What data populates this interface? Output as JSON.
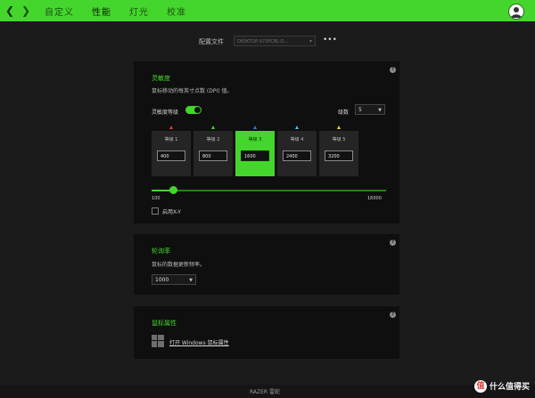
{
  "nav": {
    "tabs": [
      {
        "label": "自定义"
      },
      {
        "label": "性能"
      },
      {
        "label": "灯光"
      },
      {
        "label": "校准"
      }
    ],
    "active_tab": "性能"
  },
  "profile": {
    "label": "配置文件",
    "value": "DESKTOP-973PCBL-D...",
    "more": "•••"
  },
  "sensitivity": {
    "title": "灵敏度",
    "description": "鼠标移动的每英寸点数 (DPI) 值。",
    "stages_toggle_label": "灵敏度等级",
    "stages_enabled": true,
    "levels_label": "级数",
    "levels_value": "5",
    "stages": [
      {
        "name": "等级 1",
        "value": "400",
        "marker_color": "#e23b3b"
      },
      {
        "name": "等级 2",
        "value": "800",
        "marker_color": "#44d62c"
      },
      {
        "name": "等级 3",
        "value": "1600",
        "marker_color": "#2a7bdc"
      },
      {
        "name": "等级 4",
        "value": "2400",
        "marker_color": "#3fc6d6"
      },
      {
        "name": "等级 5",
        "value": "3200",
        "marker_color": "#e9d63a"
      }
    ],
    "active_stage": 3,
    "slider_min": "100",
    "slider_max": "16000",
    "slider_value": 1600,
    "enable_xy_label": "启用X-Y"
  },
  "polling": {
    "title": "轮询率",
    "description": "鼠标的数据更新频率。",
    "value": "1000"
  },
  "mouse_props": {
    "title": "鼠标属性",
    "link": "打开 Windows 鼠标属性"
  },
  "footer": {
    "text": "RAZER 雷蛇"
  },
  "watermark": {
    "text": "什么值得买",
    "badge": "值"
  },
  "colors": {
    "accent": "#44d62c",
    "background": "#1b1b1b",
    "card": "#0f0f0f"
  }
}
